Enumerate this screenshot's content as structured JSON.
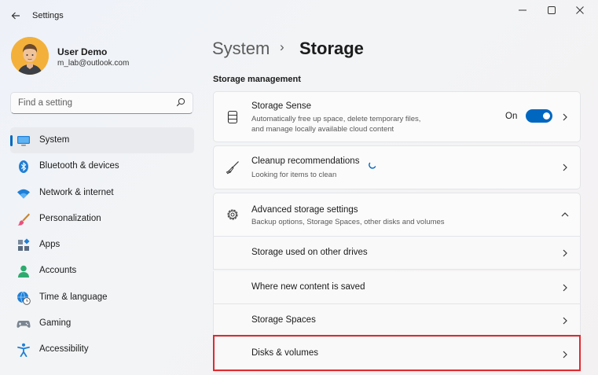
{
  "window": {
    "title": "Settings"
  },
  "user": {
    "name": "User Demo",
    "email": "m_lab@outlook.com"
  },
  "search": {
    "placeholder": "Find a setting"
  },
  "nav": {
    "items": [
      {
        "label": "System",
        "icon": "system-icon",
        "active": true
      },
      {
        "label": "Bluetooth & devices",
        "icon": "bluetooth-icon"
      },
      {
        "label": "Network & internet",
        "icon": "wifi-icon"
      },
      {
        "label": "Personalization",
        "icon": "brush-icon"
      },
      {
        "label": "Apps",
        "icon": "apps-icon"
      },
      {
        "label": "Accounts",
        "icon": "accounts-icon"
      },
      {
        "label": "Time & language",
        "icon": "globe-clock-icon"
      },
      {
        "label": "Gaming",
        "icon": "gamepad-icon"
      },
      {
        "label": "Accessibility",
        "icon": "accessibility-icon"
      }
    ]
  },
  "breadcrumb": {
    "parent": "System",
    "separator": "›",
    "current": "Storage"
  },
  "section": {
    "title": "Storage management"
  },
  "storage_sense": {
    "title": "Storage Sense",
    "desc1": "Automatically free up space, delete temporary files,",
    "desc2": "and manage locally available cloud content",
    "toggle_label": "On",
    "toggle_on": true
  },
  "cleanup": {
    "title": "Cleanup recommendations",
    "desc": "Looking for items to clean"
  },
  "advanced": {
    "title": "Advanced storage settings",
    "desc": "Backup options, Storage Spaces, other disks and volumes",
    "expanded": true,
    "items": [
      {
        "label": "Storage used on other drives"
      },
      {
        "label": "Where new content is saved"
      },
      {
        "label": "Storage Spaces"
      },
      {
        "label": "Disks & volumes"
      }
    ]
  },
  "colors": {
    "accent": "#0067c0",
    "highlight": "#e02a2f"
  }
}
